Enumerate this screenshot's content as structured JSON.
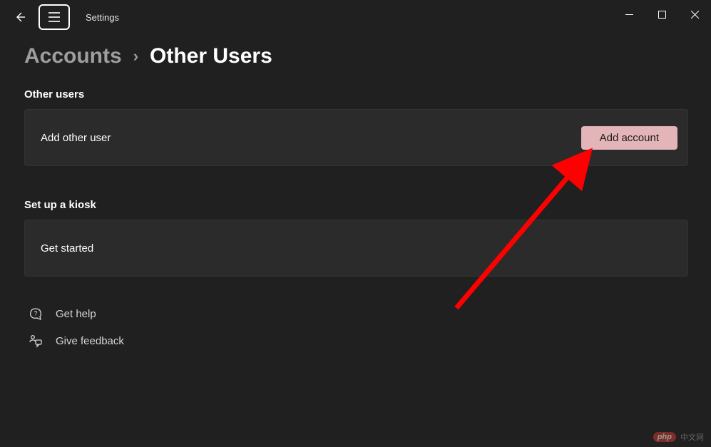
{
  "app": {
    "title": "Settings"
  },
  "breadcrumb": {
    "parent": "Accounts",
    "separator": "›",
    "current": "Other Users"
  },
  "sections": {
    "otherUsers": {
      "heading": "Other users",
      "row_label": "Add other user",
      "button_label": "Add account"
    },
    "kiosk": {
      "heading": "Set up a kiosk",
      "row_label": "Get started"
    }
  },
  "help": {
    "get_help": "Get help",
    "give_feedback": "Give feedback"
  },
  "watermark": {
    "logo": "php",
    "text": "中文网"
  },
  "colors": {
    "background": "#202020",
    "card": "#2b2b2b",
    "button": "#e3b4b8",
    "annotation_arrow": "#ff0000"
  }
}
